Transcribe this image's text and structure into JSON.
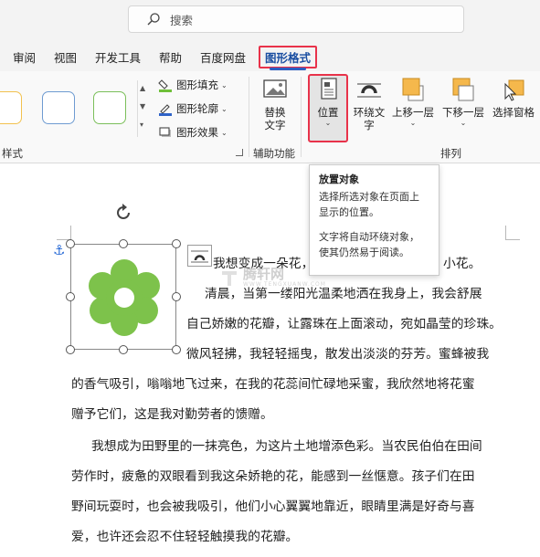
{
  "search": {
    "placeholder": "搜索",
    "icon": "search-icon"
  },
  "tabs": [
    {
      "label": "审阅"
    },
    {
      "label": "视图"
    },
    {
      "label": "开发工具"
    },
    {
      "label": "帮助"
    },
    {
      "label": "百度网盘"
    },
    {
      "label": "图形格式",
      "active": true
    }
  ],
  "ribbon": {
    "styles_group": {
      "label": "样式",
      "samples": [
        "#f2c14e",
        "#6e9bd1",
        "#7bbf5a"
      ],
      "fill": "图形填充",
      "outline": "图形轮廓",
      "effects": "图形效果"
    },
    "accessibility_group": {
      "label": "辅助功能",
      "alt_text_line1": "替换",
      "alt_text_line2": "文字"
    },
    "arrange_group": {
      "label": "排列",
      "position": "位置",
      "wrap_line1": "环绕文",
      "wrap_line2": "字",
      "bring_forward": "上移一层",
      "send_backward": "下移一层",
      "selection_pane": "选择窗格"
    }
  },
  "tooltip": {
    "title": "放置对象",
    "desc1": "选择所选对象在页面上",
    "desc2": "显示的位置。",
    "desc3": "文字将自动环绕对象，",
    "desc4": "使其仍然易于阅读。"
  },
  "document": {
    "lines": [
      "我想变成一朵花，",
      "小花。",
      "清晨，当第一缕阳光温柔地洒在我身上，我会舒展",
      "自己娇嫩的花瓣，让露珠在上面滚动，宛如晶莹的珍珠。",
      "微风轻拂，我轻轻摇曳，散发出淡淡的芬芳。蜜蜂被我",
      "的香气吸引，嗡嗡地飞过来，在我的花蕊间忙碌地采蜜，我欣然地将花蜜",
      "赠予它们，这是我对勤劳者的馈赠。",
      "我想成为田野里的一抹亮色，为这片土地增添色彩。当农民伯伯在田间",
      "劳作时，疲惫的双眼看到我这朵娇艳的花，能感到一丝惬意。孩子们在田",
      "野间玩耍时，也会被我吸引，他们小心翼翼地靠近，眼睛里满是好奇与喜",
      "爱，也许还会忍不住轻轻触摸我的花瓣。"
    ],
    "watermark": "腾轩网",
    "watermark_sub": "WWW.TENGXUANW.COM",
    "flower_color": "#7dc24b"
  },
  "colors": {
    "accent_red": "#e8324a",
    "active_tab": "#1a4ea1"
  }
}
